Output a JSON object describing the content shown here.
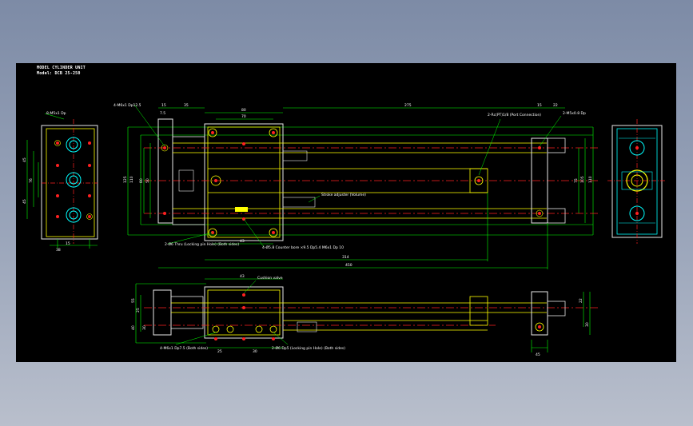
{
  "drawing": {
    "title_block": {
      "model": "MODEL CYLINDER UNIT",
      "model_no": "Model: DCB 25-250"
    },
    "notes": {
      "top_left_thread": "4-M6x1 Dp12.5",
      "top_left_hole": "8-M5x1 Dp",
      "port_connection": "2-Rc(PT)1/8 (Port Connection)",
      "rear_thread": "2-M5x0.8 Dp",
      "stroke_adjuster": "Stroke adjuster (Volume)",
      "counterbore_left": "2-Ø6 Thru (Locking pin Hole) (Both sides)",
      "counterbore_bottom": "4-Ø5.8 Counter bore ×9.5 Dp5.4 M6x1 Dp 10",
      "bottom_thread": "4-M6x1 Dp7.5 (Both sides)",
      "bottom_pin": "2-Ø6 Dp5 (Locking pin Hole) (Both sides)",
      "cushion": "Cushion valve"
    },
    "dimensions": {
      "top": [
        "15",
        "35",
        "80",
        "70",
        "275",
        "15",
        "22"
      ],
      "top_left_small": "7.5",
      "left_side": [
        "125",
        "110",
        "80",
        "50"
      ],
      "right_side": [
        "75",
        "105",
        "110"
      ],
      "inner_left": [
        "60",
        "92",
        "30"
      ],
      "inner": "60",
      "body_depth": "43",
      "overall_inner": "314",
      "overall": "450",
      "end_view": [
        "45",
        "76",
        "45",
        "15",
        "38"
      ],
      "bottom_top": "43",
      "bottom_left": [
        "55",
        "25",
        "40",
        "30"
      ],
      "bottom_lower": [
        "25",
        "30"
      ],
      "bottom_right": [
        "22",
        "30",
        "45",
        "19"
      ]
    }
  }
}
